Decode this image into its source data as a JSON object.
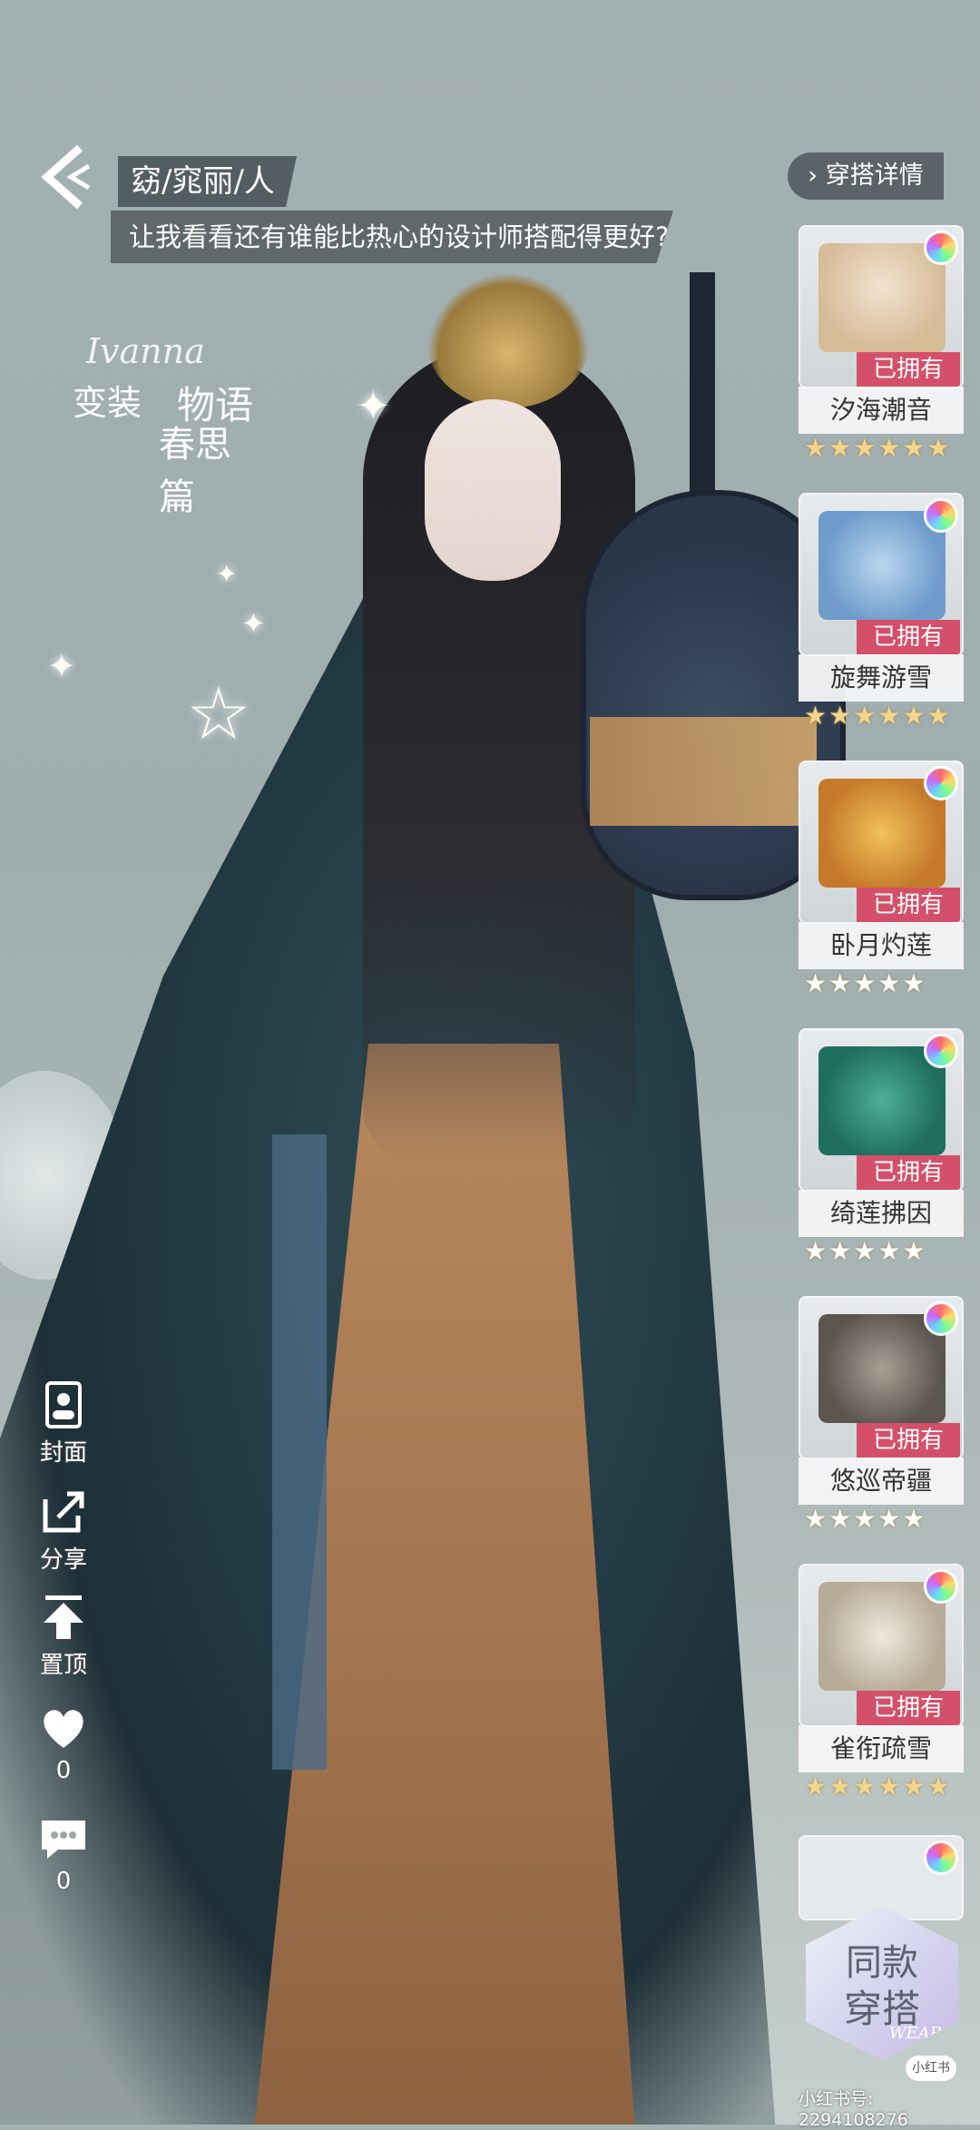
{
  "header": {
    "title": "窈/窕丽/人",
    "speech": "让我看看还有谁能比热心的设计师搭配得更好?",
    "outfit_detail_label": "穿搭详情"
  },
  "logo": {
    "script": "Ivanna",
    "line1": "变装",
    "line2": "物语",
    "line3": "春思篇"
  },
  "items": [
    {
      "name": "汐海潮音",
      "status": "已拥有",
      "stars": "★★★★★★",
      "color": "#e6d2b8"
    },
    {
      "name": "旋舞游雪",
      "status": "已拥有",
      "stars": "★★★★★★",
      "color": "#8fb9df"
    },
    {
      "name": "卧月灼莲",
      "status": "已拥有",
      "stars": "★★★★★",
      "color": "#e9a43c"
    },
    {
      "name": "绮莲拂因",
      "status": "已拥有",
      "stars": "★★★★★",
      "color": "#2f8a79"
    },
    {
      "name": "悠巡帝疆",
      "status": "已拥有",
      "stars": "★★★★★",
      "color": "#7a7268"
    },
    {
      "name": "雀衔疏雪",
      "status": "已拥有",
      "stars": "★★★★★★",
      "color": "#d7d2c8"
    }
  ],
  "same_outfit": {
    "line1": "同款",
    "line2": "穿搭",
    "tag": "WEAR"
  },
  "watermark": {
    "badge": "小红书",
    "id_text": "小红书号: 2294108276"
  },
  "actions": {
    "cover": "封面",
    "share": "分享",
    "pin": "置顶",
    "like_count": "0",
    "comment_count": "0"
  }
}
